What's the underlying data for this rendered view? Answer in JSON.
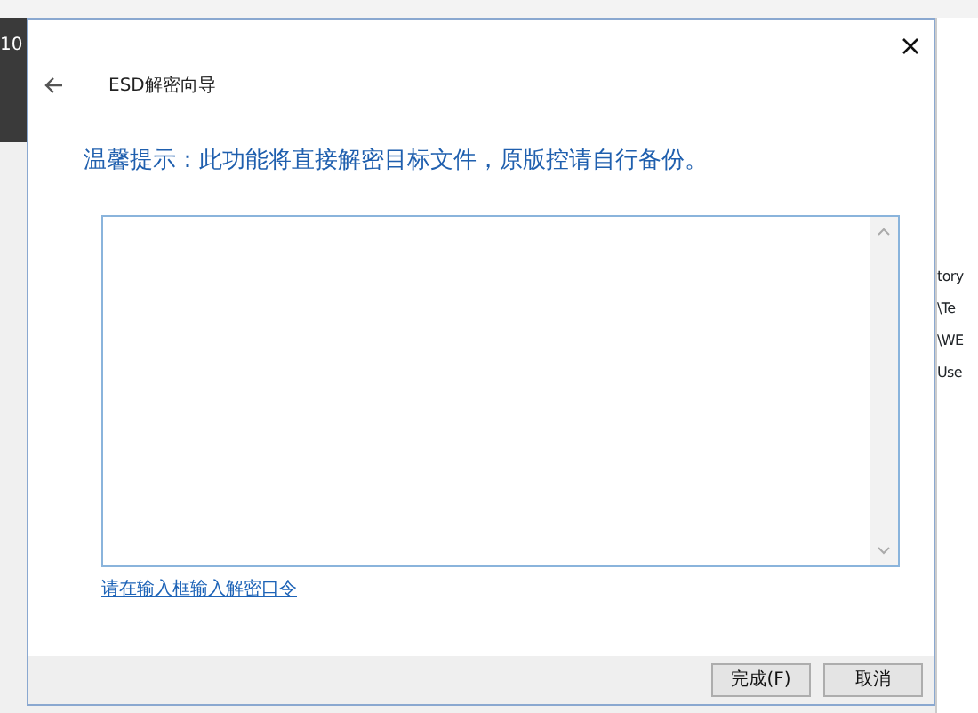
{
  "background_window": {
    "label": "10",
    "fragments": [
      "tory",
      "\\Te",
      "\\WE",
      "Use"
    ]
  },
  "dialog": {
    "title": "ESD解密向导",
    "notice": "温馨提示：此功能将直接解密目标文件，原版控请自行备份。",
    "link": "请在输入框输入解密口令",
    "buttons": [
      {
        "label": "完成(F)"
      },
      {
        "label": "取消"
      }
    ]
  }
}
